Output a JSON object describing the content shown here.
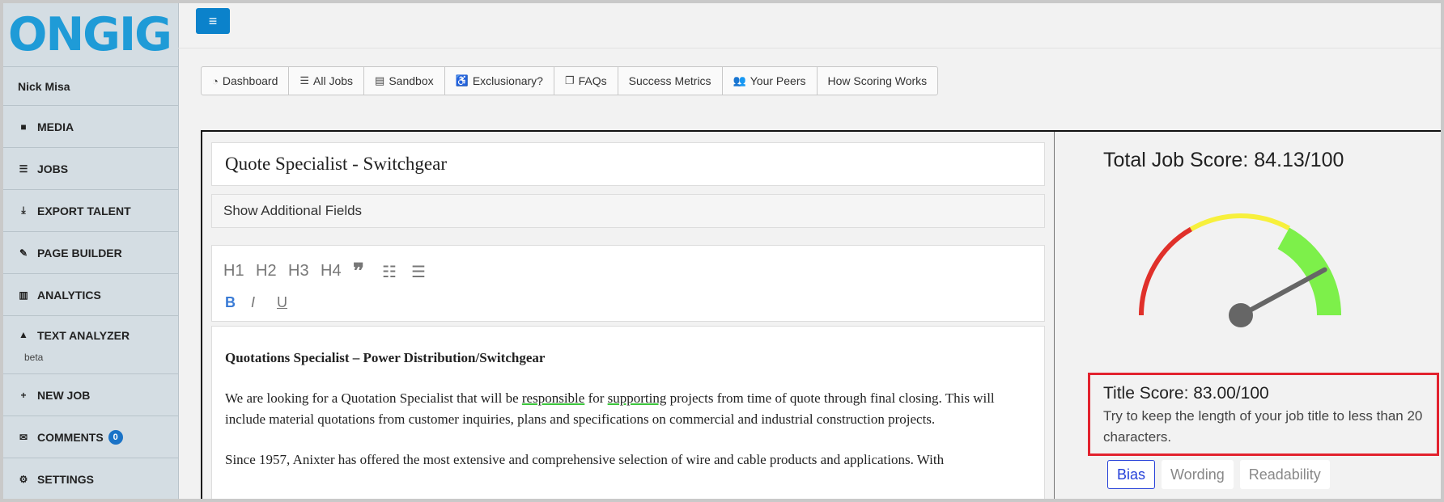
{
  "brand": {
    "logo_text": "ONGIG",
    "color": "#1f9bd7"
  },
  "sidebar": {
    "user": "Nick Misa",
    "items": [
      {
        "label": "MEDIA",
        "icon": "video-camera-icon"
      },
      {
        "label": "JOBS",
        "icon": "list-icon"
      },
      {
        "label": "EXPORT TALENT",
        "icon": "download-icon"
      },
      {
        "label": "PAGE BUILDER",
        "icon": "wrench-icon"
      },
      {
        "label": "ANALYTICS",
        "icon": "bar-chart-icon"
      },
      {
        "label": "TEXT ANALYZER",
        "sub": "beta",
        "icon": "graduation-cap-icon"
      },
      {
        "label": "NEW JOB",
        "icon": "plus-icon"
      },
      {
        "label": "COMMENTS",
        "badge": "0",
        "icon": "envelope-icon"
      },
      {
        "label": "SETTINGS",
        "icon": "gear-icon"
      }
    ]
  },
  "nav": {
    "tabs": [
      {
        "label": "Dashboard",
        "icon": "dashboard-icon"
      },
      {
        "label": "All Jobs",
        "icon": "list-icon"
      },
      {
        "label": "Sandbox",
        "icon": "newspaper-icon"
      },
      {
        "label": "Exclusionary?",
        "icon": "wheelchair-icon"
      },
      {
        "label": "FAQs",
        "icon": "copy-icon"
      },
      {
        "label": "Success Metrics"
      },
      {
        "label": "Your Peers",
        "icon": "users-icon"
      },
      {
        "label": "How Scoring Works"
      }
    ]
  },
  "editor": {
    "title_value": "Quote Specialist - Switchgear",
    "show_fields_label": "Show Additional Fields",
    "toolbar": {
      "h1": "H1",
      "h2": "H2",
      "h3": "H3",
      "h4": "H4",
      "bold": "B",
      "italic": "I",
      "underline": "U"
    },
    "content": {
      "heading": "Quotations Specialist – Power Distribution/Switchgear",
      "p1_a": "We are looking for a Quotation Specialist that will be ",
      "p1_w1": "responsible",
      "p1_b": " for ",
      "p1_w2": "supporting",
      "p1_c": " projects from time of quote through final closing. This will include material quotations from customer inquiries, plans and specifications on commercial and industrial construction projects.",
      "p2": "Since 1957, Anixter has offered the most extensive and comprehensive selection of wire and cable products and applications. With"
    }
  },
  "score": {
    "total_label": "Total Job Score: 84.13/100",
    "total_value": 84.13,
    "title_label": "Title Score: 83.00/100",
    "title_tip": "Try to keep the length of your job title to less than 20 characters.",
    "tabs": [
      "Bias",
      "Wording",
      "Readability"
    ],
    "active_tab": "Bias",
    "gauge_colors": {
      "low": "#e0302a",
      "mid": "#f7f03c",
      "high": "#7df04a",
      "needle": "#666666"
    }
  }
}
